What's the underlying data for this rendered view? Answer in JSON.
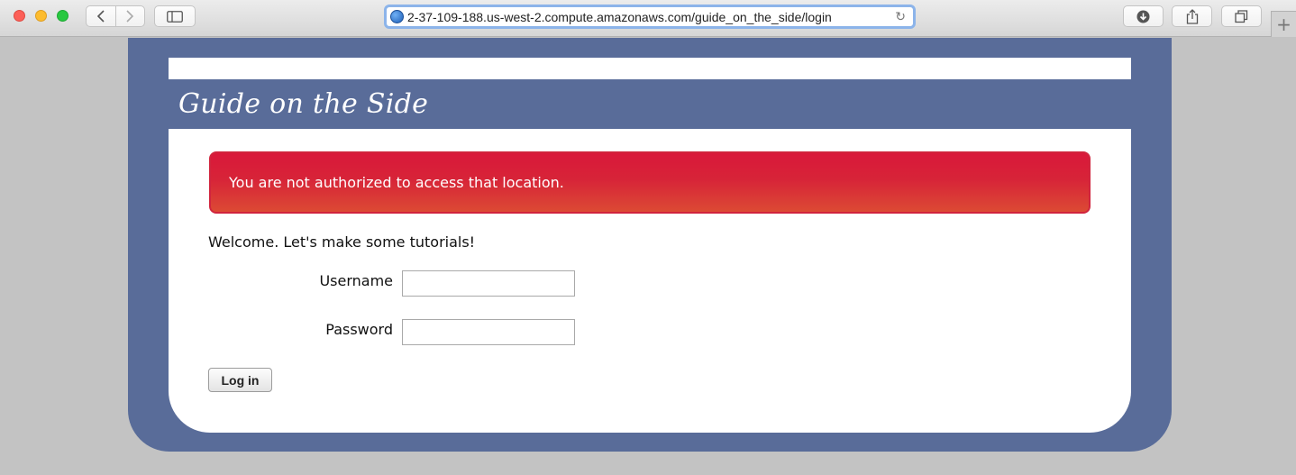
{
  "browser": {
    "url": "2-37-109-188.us-west-2.compute.amazonaws.com/guide_on_the_side/login",
    "icons": [
      "close-icon",
      "minimize-icon",
      "zoom-icon",
      "back-icon",
      "forward-icon",
      "sidebar-icon",
      "globe-icon",
      "reload-icon",
      "download-icon",
      "share-icon",
      "tabs-icon",
      "plus-icon"
    ]
  },
  "site": {
    "title": "Guide on the Side",
    "accent_color": "#596c99"
  },
  "flash": {
    "message": "You are not authorized to access that location.",
    "color": "#d9183a"
  },
  "login": {
    "welcome": "Welcome. Let's make some tutorials!",
    "username_label": "Username",
    "username_value": "",
    "password_label": "Password",
    "password_value": "",
    "submit_label": "Log in"
  }
}
